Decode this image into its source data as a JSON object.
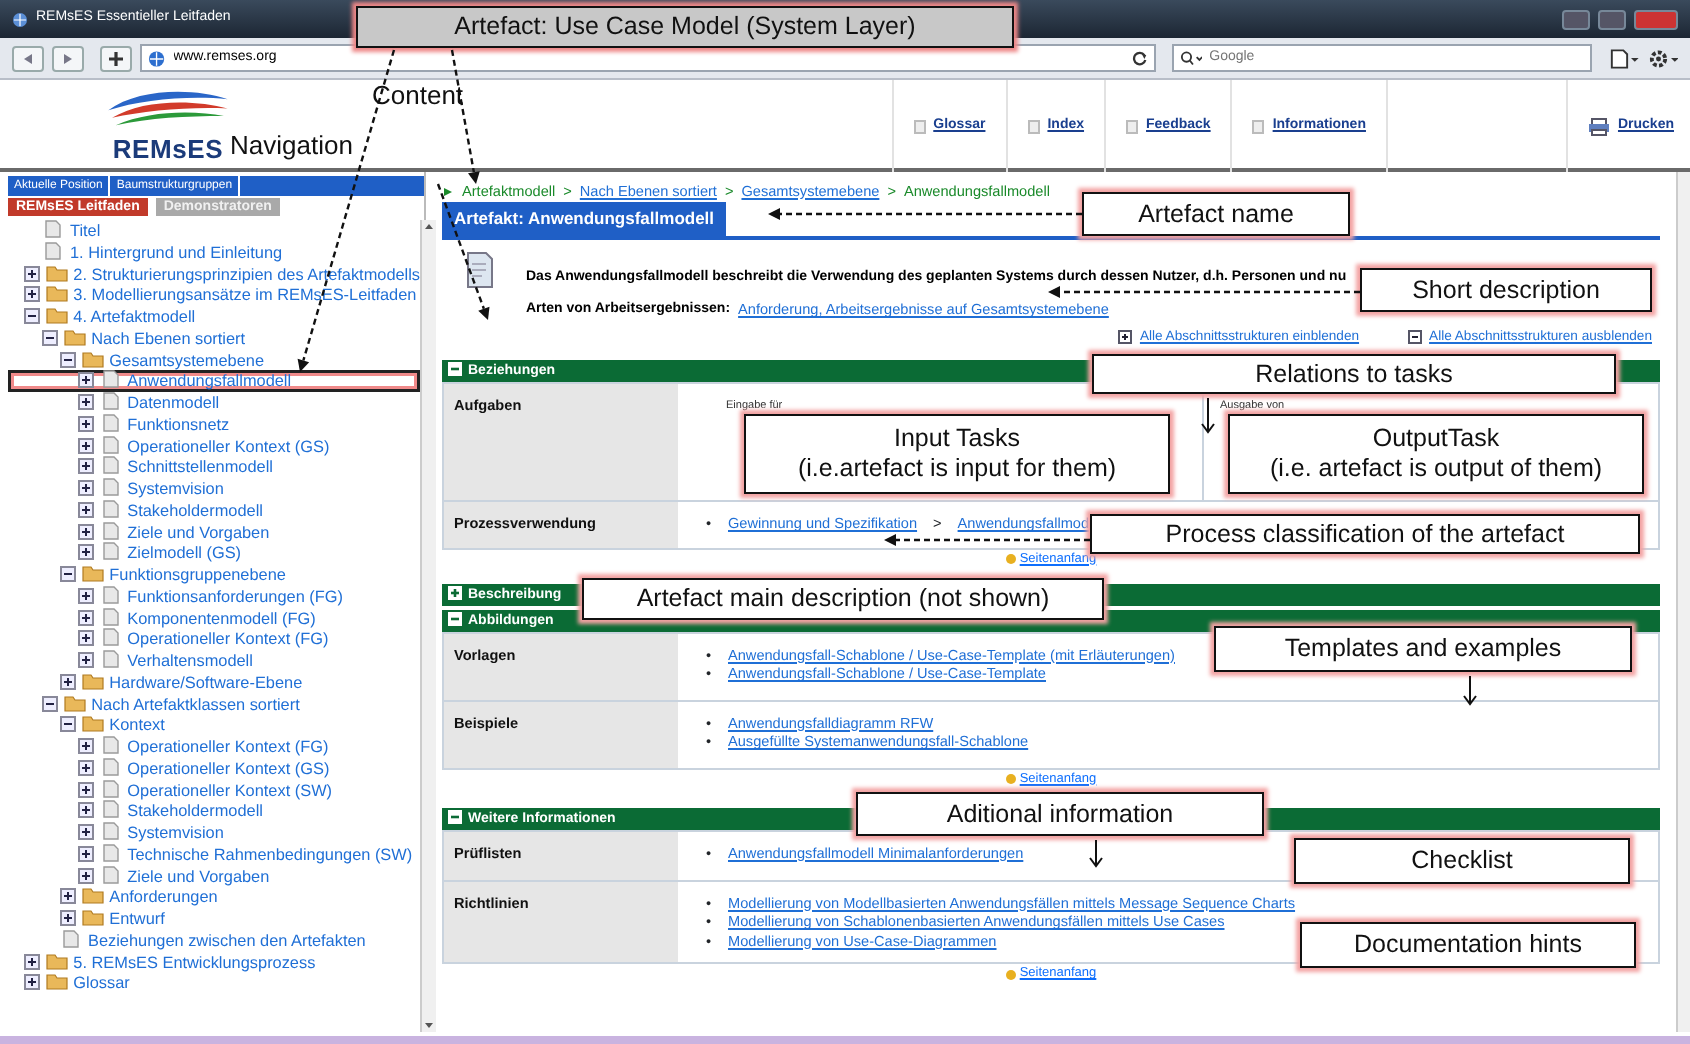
{
  "window": {
    "title": "REMsES Essentieller Leitfaden"
  },
  "browser": {
    "url": "www.remses.org",
    "search": {
      "placeholder": "Google"
    }
  },
  "site": {
    "logo": "REMsES",
    "nav": [
      {
        "label": "Glossar"
      },
      {
        "label": "Index"
      },
      {
        "label": "Feedback"
      },
      {
        "label": "Informationen"
      }
    ],
    "print": "Drucken"
  },
  "sidebar": {
    "top_tabs": [
      "Aktuelle Position",
      "Baumstrukturgruppen"
    ],
    "tabs": [
      {
        "label": "REMsES Leitfaden",
        "selected": true
      },
      {
        "label": "Demonstratoren",
        "selected": false
      }
    ],
    "tree": [
      {
        "label": "Titel",
        "kind": "page",
        "highlighted": false
      },
      {
        "label": "1. Hintergrund und Einleitung",
        "kind": "page",
        "highlighted": false
      },
      {
        "label": "2. Strukturierungsprinzipien des Artefaktmodells",
        "kind": "folder",
        "expanded": false,
        "highlighted": false
      },
      {
        "label": "3. Modellierungsansätze im REMsES-Leitfaden",
        "kind": "folder",
        "expanded": false,
        "highlighted": false
      },
      {
        "label": "4. Artefaktmodell",
        "kind": "folder",
        "expanded": true,
        "highlighted": false,
        "children": [
          {
            "label": "Nach Ebenen sortiert",
            "kind": "folder",
            "expanded": true,
            "highlighted": false,
            "children": [
              {
                "label": "Gesamtsystemebene",
                "kind": "folder",
                "expanded": true,
                "highlighted": false,
                "children": [
                  {
                    "label": "Anwendungsfallmodell",
                    "kind": "page",
                    "expanded": false,
                    "highlighted": true
                  },
                  {
                    "label": "Datenmodell",
                    "kind": "page",
                    "expanded": false,
                    "highlighted": false
                  },
                  {
                    "label": "Funktionsnetz",
                    "kind": "page",
                    "expanded": false,
                    "highlighted": false
                  },
                  {
                    "label": "Operationeller Kontext (GS)",
                    "kind": "page",
                    "expanded": false,
                    "highlighted": false
                  },
                  {
                    "label": "Schnittstellenmodell",
                    "kind": "page",
                    "expanded": false,
                    "highlighted": false
                  },
                  {
                    "label": "Systemvision",
                    "kind": "page",
                    "expanded": false,
                    "highlighted": false
                  },
                  {
                    "label": "Stakeholdermodell",
                    "kind": "page",
                    "expanded": false,
                    "highlighted": false
                  },
                  {
                    "label": "Ziele und Vorgaben",
                    "kind": "page",
                    "expanded": false,
                    "highlighted": false
                  },
                  {
                    "label": "Zielmodell (GS)",
                    "kind": "page",
                    "expanded": false,
                    "highlighted": false
                  }
                ]
              },
              {
                "label": "Funktionsgruppenebene",
                "kind": "folder",
                "expanded": true,
                "highlighted": false,
                "children": [
                  {
                    "label": "Funktionsanforderungen (FG)",
                    "kind": "page",
                    "expanded": false,
                    "highlighted": false
                  },
                  {
                    "label": "Komponentenmodell (FG)",
                    "kind": "page",
                    "expanded": false,
                    "highlighted": false
                  },
                  {
                    "label": "Operationeller Kontext (FG)",
                    "kind": "page",
                    "expanded": false,
                    "highlighted": false
                  },
                  {
                    "label": "Verhaltensmodell",
                    "kind": "page",
                    "expanded": false,
                    "highlighted": false
                  }
                ]
              },
              {
                "label": "Hardware/Software-Ebene",
                "kind": "folder",
                "expanded": false,
                "highlighted": false
              }
            ]
          },
          {
            "label": "Nach Artefaktklassen sortiert",
            "kind": "folder",
            "expanded": true,
            "highlighted": false,
            "children": [
              {
                "label": "Kontext",
                "kind": "folder",
                "expanded": true,
                "highlighted": false,
                "children": [
                  {
                    "label": "Operationeller Kontext (FG)",
                    "kind": "page",
                    "expanded": false,
                    "highlighted": false
                  },
                  {
                    "label": "Operationeller Kontext (GS)",
                    "kind": "page",
                    "expanded": false,
                    "highlighted": false
                  },
                  {
                    "label": "Operationeller Kontext (SW)",
                    "kind": "page",
                    "expanded": false,
                    "highlighted": false
                  },
                  {
                    "label": "Stakeholdermodell",
                    "kind": "page",
                    "expanded": false,
                    "highlighted": false
                  },
                  {
                    "label": "Systemvision",
                    "kind": "page",
                    "expanded": false,
                    "highlighted": false
                  },
                  {
                    "label": "Technische Rahmenbedingungen (SW)",
                    "kind": "page",
                    "expanded": false,
                    "highlighted": false
                  },
                  {
                    "label": "Ziele und Vorgaben",
                    "kind": "page",
                    "expanded": false,
                    "highlighted": false
                  }
                ]
              },
              {
                "label": "Anforderungen",
                "kind": "folder",
                "expanded": false,
                "highlighted": false
              },
              {
                "label": "Entwurf",
                "kind": "folder",
                "expanded": false,
                "highlighted": false
              }
            ]
          },
          {
            "label": "Beziehungen zwischen den Artefakten",
            "kind": "page",
            "highlighted": false
          }
        ]
      },
      {
        "label": "5. REMsES Entwicklungsprozess",
        "kind": "folder",
        "expanded": false,
        "highlighted": false
      },
      {
        "label": "Glossar",
        "kind": "folder",
        "expanded": false,
        "highlighted": false
      }
    ]
  },
  "content": {
    "bullet": "•",
    "breadcrumb": [
      "Artefaktmodell",
      "Nach Ebenen sortiert",
      "Gesamtsystemebene",
      "Anwendungsfallmodell"
    ],
    "separator": ">",
    "title": "Artefakt: Anwendungsfallmodell",
    "description": "Das Anwendungsfallmodell beschreibt die Verwendung des geplanten Systems durch dessen Nutzer, d.h. Personen und nu",
    "result_types_label": "Arten von Arbeitsergebnissen:",
    "result_types": "Anforderung, Arbeitsergebnisse auf Gesamtsystemebene",
    "expand_all": "Alle Abschnittsstrukturen einblenden",
    "collapse_all": "Alle Abschnittsstrukturen ausblenden",
    "sections": [
      {
        "title": "Beziehungen",
        "expanded": true,
        "top_link": "Seitenanfang",
        "rows": [
          {
            "label": "Aufgaben",
            "kind": "tasks",
            "input_label": "Eingabe für",
            "output_label": "Ausgabe von"
          },
          {
            "label": "Prozessverwendung",
            "kind": "path",
            "items": [
              "Gewinnung und Spezifikation",
              "Anwendungsfallmod"
            ]
          }
        ]
      },
      {
        "title": "Beschreibung",
        "expanded": false
      },
      {
        "title": "Abbildungen",
        "expanded": true,
        "top_link": "Seitenanfang",
        "rows": [
          {
            "label": "Vorlagen",
            "kind": "links",
            "links": [
              "Anwendungsfall-Schablone / Use-Case-Template (mit Erläuterungen)",
              "Anwendungsfall-Schablone / Use-Case-Template"
            ]
          },
          {
            "label": "Beispiele",
            "kind": "links",
            "links": [
              "Anwendungsfalldiagramm RFW",
              "Ausgefüllte Systemanwendungsfall-Schablone"
            ]
          }
        ]
      },
      {
        "title": "Weitere Informationen",
        "expanded": true,
        "top_link": "Seitenanfang",
        "rows": [
          {
            "label": "Prüflisten",
            "kind": "links",
            "links": [
              "Anwendungsfallmodell Minimalanforderungen"
            ]
          },
          {
            "label": "Richtlinien",
            "kind": "links",
            "links": [
              "Modellierung von Modellbasierten Anwendungsfällen mittels Message Sequence Charts",
              "Modellierung von Schablonenbasierten Anwendungsfällen mittels Use Cases",
              "Modellierung von Use-Case-Diagrammen"
            ]
          }
        ]
      }
    ]
  },
  "annotations": [
    {
      "kind": "banner",
      "lines": [
        "Artefact: Use Case Model  (System Layer)"
      ]
    },
    {
      "kind": "label",
      "lines": [
        "Content"
      ]
    },
    {
      "kind": "label",
      "lines": [
        "Navigation"
      ]
    },
    {
      "kind": "box",
      "lines": [
        "Artefact name"
      ]
    },
    {
      "kind": "box",
      "lines": [
        "Short description"
      ]
    },
    {
      "kind": "box",
      "lines": [
        "Relations to tasks"
      ]
    },
    {
      "kind": "box",
      "lines": [
        "Input Tasks",
        "(i.e.artefact is input for them)"
      ]
    },
    {
      "kind": "box",
      "lines": [
        "OutputTask",
        "(i.e. artefact is output of them)"
      ]
    },
    {
      "kind": "box",
      "lines": [
        "Process classification of the artefact"
      ]
    },
    {
      "kind": "box",
      "lines": [
        "Artefact main description (not shown)"
      ]
    },
    {
      "kind": "box",
      "lines": [
        "Templates and examples"
      ]
    },
    {
      "kind": "box",
      "lines": [
        "Aditional information"
      ]
    },
    {
      "kind": "box",
      "lines": [
        "Checklist"
      ]
    },
    {
      "kind": "box",
      "lines": [
        "Documentation hints"
      ]
    }
  ]
}
